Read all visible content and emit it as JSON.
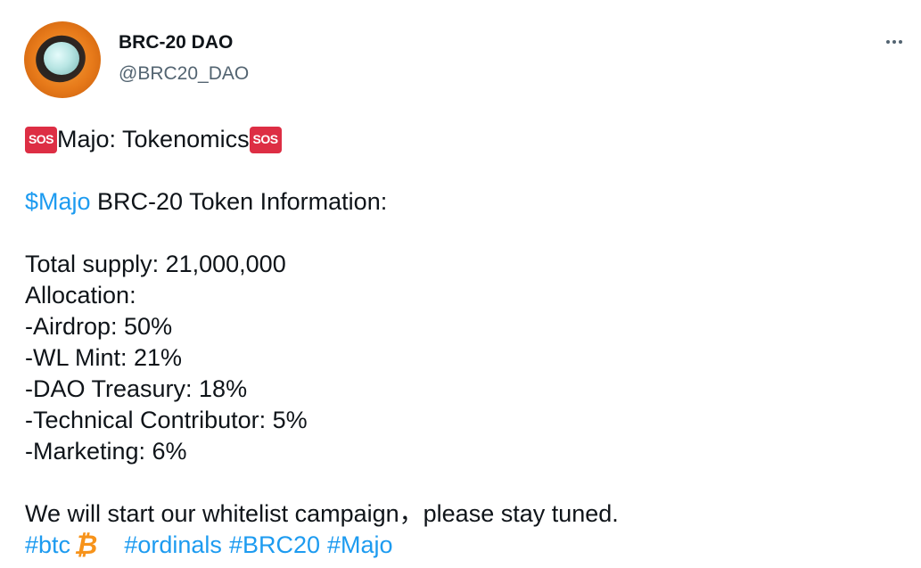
{
  "author": {
    "display_name": "BRC-20 DAO",
    "handle": "@BRC20_DAO",
    "avatar_icon": "orange-ring-avatar"
  },
  "menu": {
    "icon": "more-options-icon"
  },
  "tweet": {
    "title_emoji": "🆘",
    "title_text": "Majo: Tokenomics",
    "cashtag": "$Majo",
    "token_info_text": " BRC-20 Token Information:",
    "lines": [
      "Total supply: 21,000,000",
      "Allocation:",
      "-Airdrop: 50%",
      "-WL Mint: 21%",
      "-DAO Treasury: 18%",
      "-Technical Contributor: 5%",
      "-Marketing: 6%"
    ],
    "closing_text": "We will start our whitelist campaign，please stay tuned.",
    "hashtags": [
      "#btc",
      "#ordinals",
      "#BRC20",
      "#Majo"
    ],
    "btc_emoji": "₿"
  },
  "colors": {
    "link": "#1d9bf0",
    "text": "#0f1419",
    "secondary": "#536471",
    "sos_badge": "#dd2e44",
    "bitcoin": "#f7931a"
  }
}
